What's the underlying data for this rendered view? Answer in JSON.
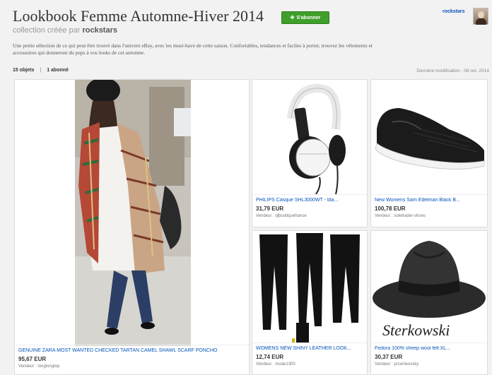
{
  "header": {
    "title": "Lookbook Femme Automne-Hiver 2014",
    "subscribe_label": "S'abonner",
    "user_name": "rockstars",
    "subtitle_prefix": "collection créée par",
    "subtitle_owner": "rockstars",
    "description": "Une petite sélection de ce qui peut être trouvé dans l'univers eBay, avec les must-have de cette saison. Confortables, tendances et faciles à porter, trouvez les vêtements et accessoires qui donneront du peps à vos looks de cet automne."
  },
  "stats": {
    "items": "15 objets",
    "separator": "|",
    "followers": "1 abonné",
    "modified": "Dernière modification : 06 oct. 2014"
  },
  "items": [
    {
      "name": "GENUINE ZARA MOST WANTED CHECKED TARTAN CAMEL SHAWL SCARF PONCHO",
      "price": "95,67 EUR",
      "seller": "Vendeur : longlongtop"
    },
    {
      "name": "PHILIPS Casque SHL3000WT - bla...",
      "price": "31,79 EUR",
      "seller": "Vendeur : djboutiquefrance"
    },
    {
      "name": "New Womens Sam Edelman Black B...",
      "price": "100,78 EUR",
      "seller": "Vendeur : soletrader-shoes"
    },
    {
      "name": "WOMENS NEW SHINY LEATHER LOOK...",
      "price": "12,74 EUR",
      "seller": "Vendeur : mode1300"
    },
    {
      "name": "Fedora 100% sheep wool felt XL...",
      "price": "30,37 EUR",
      "seller": "Vendeur : przemkovsky"
    }
  ],
  "watermark": "Sterkowski",
  "icons": [
    "plus-icon",
    "avatar"
  ]
}
